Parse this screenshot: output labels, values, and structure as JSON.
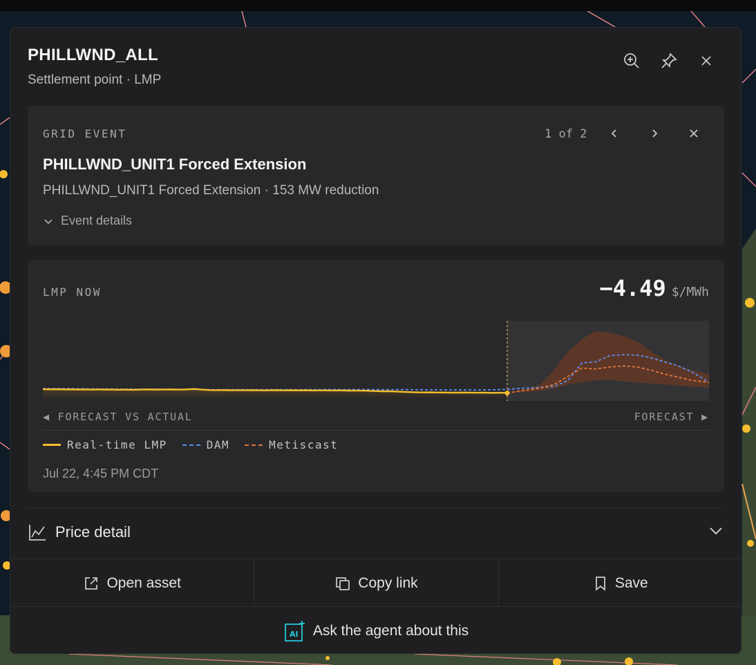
{
  "panel": {
    "title": "PHILLWND_ALL",
    "subtitle": "Settlement point · LMP",
    "header_icons": [
      "zoom-in-icon",
      "pin-icon",
      "close-icon"
    ]
  },
  "event": {
    "eyebrow": "GRID EVENT",
    "counter": "1 of 2",
    "title": "PHILLWND_UNIT1 Forced Extension",
    "description": "PHILLWND_UNIT1 Forced Extension · 153 MW reduction",
    "details_label": "Event details"
  },
  "lmp": {
    "eyebrow": "LMP NOW",
    "value": "−4.49",
    "unit": "$/MWh",
    "axis_left": "◀ FORECAST VS ACTUAL",
    "axis_right": "FORECAST ▶",
    "legend": [
      {
        "label": "Real-time LMP",
        "color": "#f5bd2e",
        "style": "solid"
      },
      {
        "label": "DAM",
        "color": "#5b8ff0",
        "style": "dashed"
      },
      {
        "label": "Metiscast",
        "color": "#e8763a",
        "style": "dashed"
      }
    ],
    "timestamp": "Jul 22, 4:45 PM CDT"
  },
  "price_detail": {
    "label": "Price detail"
  },
  "actions": {
    "open_asset": "Open asset",
    "copy_link": "Copy link",
    "save": "Save",
    "ask_agent": "Ask the agent about this",
    "ai_badge": "AI"
  },
  "colors": {
    "realtime": "#f5bd2e",
    "dam": "#5b8ff0",
    "metiscast": "#e8763a",
    "band": "#6b3a24",
    "panel_bg": "#1f1f21",
    "card_bg": "#28282a",
    "ai_accent": "#26c6da"
  },
  "chart_data": {
    "type": "line",
    "series": [
      {
        "name": "Real-time LMP",
        "x": [
          0,
          10,
          20,
          30,
          40,
          50,
          60,
          70,
          80,
          90,
          100,
          110,
          120,
          130,
          140,
          150,
          160,
          170,
          180,
          190,
          200,
          210,
          220,
          230,
          240,
          250,
          260,
          270,
          280,
          290,
          300,
          310,
          320,
          330,
          340,
          350,
          360,
          370,
          380,
          390,
          400,
          410,
          420,
          430,
          440,
          450,
          460,
          470,
          480,
          490,
          500,
          510,
          520,
          530,
          540,
          550,
          560,
          570,
          580,
          590,
          600,
          610,
          620,
          630,
          640,
          650,
          660,
          670,
          672
        ],
        "values": [
          3.5,
          3.3,
          3.4,
          3.2,
          3.3,
          3.1,
          3.2,
          3.0,
          3.2,
          3.0,
          3.1,
          2.9,
          3.0,
          2.8,
          3.0,
          3.2,
          3.1,
          3.0,
          3.2,
          3.1,
          3.0,
          3.3,
          3.6,
          3.0,
          2.6,
          2.5,
          2.6,
          2.4,
          2.5,
          2.5,
          2.4,
          2.5,
          2.3,
          2.4,
          2.5,
          2.3,
          2.4,
          2.3,
          2.4,
          2.2,
          2.3,
          2.3,
          2.2,
          2.3,
          2.1,
          2.0,
          2.0,
          1.9,
          1.6,
          1.4,
          1.4,
          1.2,
          0.9,
          0.6,
          0.4,
          0.3,
          0.4,
          0.2,
          0.3,
          0.1,
          0.1,
          0.2,
          0.1,
          0.0,
          0.1,
          -0.1,
          0.0,
          -0.1,
          -0.3
        ]
      },
      {
        "name": "DAM",
        "x": [
          0,
          40,
          80,
          120,
          160,
          200,
          240,
          280,
          320,
          360,
          400,
          440,
          480,
          520,
          560,
          600,
          640,
          672,
          700,
          720,
          740,
          760,
          780,
          800,
          820,
          840,
          860,
          880,
          900,
          920,
          940,
          964
        ],
        "values": [
          4.0,
          4.0,
          3.6,
          3.4,
          3.4,
          3.2,
          3.0,
          3.0,
          3.0,
          3.0,
          3.0,
          3.1,
          3.0,
          3.0,
          2.8,
          2.6,
          2.7,
          3.2,
          4.6,
          5.2,
          6.0,
          12.0,
          29.0,
          30.0,
          36.0,
          37.0,
          36.5,
          34.0,
          30.0,
          26.0,
          20.0,
          10.0
        ]
      },
      {
        "name": "Metiscast",
        "x": [
          672,
          700,
          720,
          740,
          760,
          780,
          800,
          820,
          840,
          860,
          880,
          900,
          920,
          940,
          964
        ],
        "values": [
          -0.3,
          2.5,
          4.5,
          8.0,
          16.0,
          24.0,
          23.0,
          25.0,
          26.0,
          25.0,
          22.0,
          18.0,
          15.0,
          12.0,
          10.0
        ]
      },
      {
        "name": "band_upper",
        "x": [
          672,
          700,
          720,
          740,
          760,
          780,
          800,
          820,
          840,
          860,
          880,
          900,
          920,
          940,
          964
        ],
        "values": [
          -0.3,
          4.0,
          8.0,
          22.0,
          40.0,
          52.0,
          60.0,
          58.0,
          55.0,
          50.0,
          40.0,
          32.0,
          26.0,
          22.0,
          18.0
        ]
      },
      {
        "name": "band_lower",
        "x": [
          672,
          700,
          720,
          740,
          760,
          780,
          800,
          820,
          840,
          860,
          880,
          900,
          920,
          940,
          964
        ],
        "values": [
          -0.3,
          0.8,
          2.0,
          4.0,
          8.0,
          10.0,
          12.0,
          13.0,
          11.0,
          10.0,
          9.0,
          8.0,
          7.0,
          6.0,
          5.0
        ]
      }
    ],
    "now_x": 672,
    "xlim": [
      0,
      964
    ],
    "ylim": [
      -8,
      70
    ]
  }
}
